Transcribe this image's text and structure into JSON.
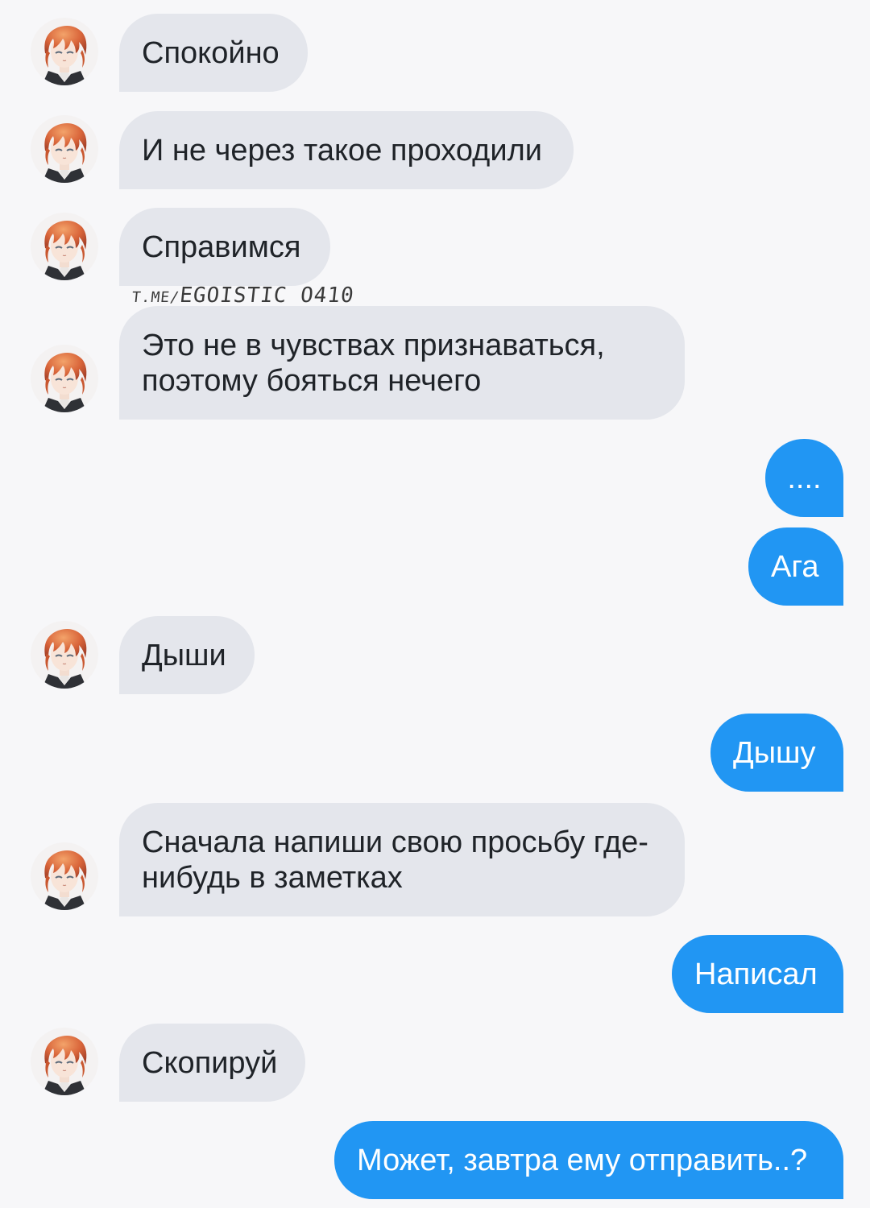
{
  "colors": {
    "background": "#f7f7f9",
    "incoming_bubble": "#e4e6ec",
    "outgoing_bubble": "#2196f3",
    "incoming_text": "#1f2328",
    "outgoing_text": "#ffffff"
  },
  "watermark": {
    "prefix": "T.ME/",
    "handle": "EGOISTIC_O410"
  },
  "messages": [
    {
      "direction": "incoming",
      "lines": [
        "Спокойно"
      ]
    },
    {
      "direction": "incoming",
      "lines": [
        "И не через такое проходили"
      ]
    },
    {
      "direction": "incoming",
      "lines": [
        "Справимся"
      ]
    },
    {
      "direction": "incoming",
      "lines": [
        "Это не в чувствах признаваться,",
        "поэтому бояться нечего"
      ]
    },
    {
      "direction": "outgoing",
      "lines": [
        "...."
      ]
    },
    {
      "direction": "outgoing",
      "lines": [
        "Ага"
      ]
    },
    {
      "direction": "incoming",
      "lines": [
        "Дыши"
      ]
    },
    {
      "direction": "outgoing",
      "lines": [
        "Дышу"
      ]
    },
    {
      "direction": "incoming",
      "lines": [
        "Сначала напиши свою просьбу где-",
        "нибудь в заметках"
      ]
    },
    {
      "direction": "outgoing",
      "lines": [
        "Написал"
      ]
    },
    {
      "direction": "incoming",
      "lines": [
        "Скопируй"
      ]
    },
    {
      "direction": "outgoing",
      "lines": [
        "Может, завтра ему отправить..?"
      ]
    }
  ],
  "avatar_icon": "anime-boy-avatar-icon"
}
